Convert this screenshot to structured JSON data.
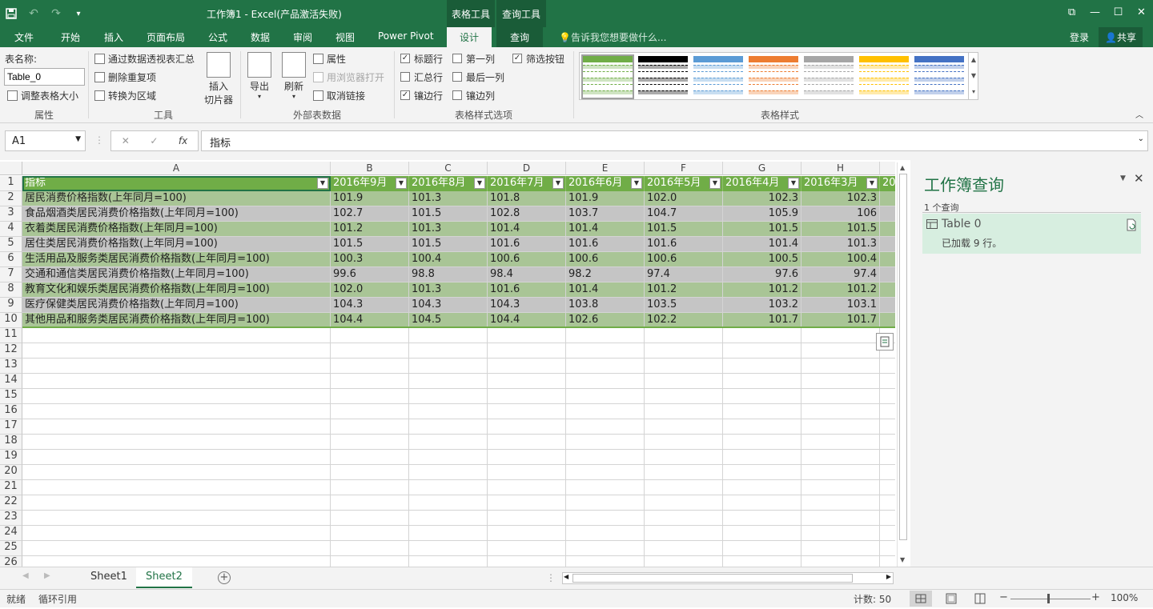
{
  "window": {
    "title": "工作簿1 - Excel(产品激活失败)",
    "context_tabs": [
      "表格工具",
      "查询工具"
    ],
    "controls": [
      "⧉",
      "—",
      "☐",
      "✕"
    ]
  },
  "menu": {
    "tabs": [
      "文件",
      "开始",
      "插入",
      "页面布局",
      "公式",
      "数据",
      "审阅",
      "视图",
      "Power Pivot",
      "设计",
      "查询"
    ],
    "tell_me": "告诉我您想要做什么...",
    "login": "登录",
    "share": "共享"
  },
  "ribbon": {
    "props": {
      "label": "表名称:",
      "table_name": "Table_0",
      "resize": "调整表格大小",
      "group": "属性"
    },
    "tools": {
      "pivot": "通过数据透视表汇总",
      "dedupe": "删除重复项",
      "to_range": "转换为区域",
      "slicer_1": "插入",
      "slicer_2": "切片器",
      "group": "工具"
    },
    "external": {
      "export": "导出",
      "refresh": "刷新",
      "properties": "属性",
      "open_browser": "用浏览器打开",
      "unlink": "取消链接",
      "group": "外部表数据"
    },
    "style_options": {
      "header_row": "标题行",
      "total_row": "汇总行",
      "banded_rows": "镶边行",
      "first_col": "第一列",
      "last_col": "最后一列",
      "banded_cols": "镶边列",
      "filter_btn": "筛选按钮",
      "group": "表格样式选项"
    },
    "styles": {
      "group": "表格样式",
      "swatches": [
        "#70ad47",
        "#000000",
        "#5b9bd5",
        "#ed7d31",
        "#a5a5a5",
        "#ffc000",
        "#4472c4"
      ]
    }
  },
  "formula_bar": {
    "cell": "A1",
    "cancel": "✕",
    "enter": "✓",
    "fx": "fx",
    "content": "指标"
  },
  "sheet": {
    "columns": [
      "A",
      "B",
      "C",
      "D",
      "E",
      "F",
      "G",
      "H"
    ],
    "header": [
      "指标",
      "2016年9月",
      "2016年8月",
      "2016年7月",
      "2016年6月",
      "2016年5月",
      "2016年4月",
      "2016年3月",
      "20"
    ],
    "rows": [
      [
        "居民消费价格指数(上年同月=100)",
        "101.9",
        "101.3",
        "101.8",
        "101.9",
        "102.0",
        "102.3",
        "102.3"
      ],
      [
        "食品烟酒类居民消费价格指数(上年同月=100)",
        "102.7",
        "101.5",
        "102.8",
        "103.7",
        "104.7",
        "105.9",
        "106"
      ],
      [
        "衣着类居民消费价格指数(上年同月=100)",
        "101.2",
        "101.3",
        "101.4",
        "101.4",
        "101.5",
        "101.5",
        "101.5"
      ],
      [
        "居住类居民消费价格指数(上年同月=100)",
        "101.5",
        "101.5",
        "101.6",
        "101.6",
        "101.6",
        "101.4",
        "101.3"
      ],
      [
        "生活用品及服务类居民消费价格指数(上年同月=100)",
        "100.3",
        "100.4",
        "100.6",
        "100.6",
        "100.6",
        "100.5",
        "100.4"
      ],
      [
        "交通和通信类居民消费价格指数(上年同月=100)",
        "99.6",
        "98.8",
        "98.4",
        "98.2",
        "97.4",
        "97.6",
        "97.4"
      ],
      [
        "教育文化和娱乐类居民消费价格指数(上年同月=100)",
        "102.0",
        "101.3",
        "101.6",
        "101.4",
        "101.2",
        "101.2",
        "101.2"
      ],
      [
        "医疗保健类居民消费价格指数(上年同月=100)",
        "104.3",
        "104.3",
        "104.3",
        "103.8",
        "103.5",
        "103.2",
        "103.1"
      ],
      [
        "其他用品和服务类居民消费价格指数(上年同月=100)",
        "104.4",
        "104.5",
        "104.4",
        "102.6",
        "102.2",
        "101.7",
        "101.7"
      ]
    ],
    "row_numbers": [
      "1",
      "2",
      "3",
      "4",
      "5",
      "6",
      "7",
      "8",
      "9",
      "10",
      "11",
      "12",
      "13",
      "14",
      "15",
      "16",
      "17",
      "18",
      "19",
      "20",
      "21",
      "22",
      "23",
      "24",
      "25",
      "26"
    ]
  },
  "sheets": {
    "tabs": [
      "Sheet1",
      "Sheet2"
    ],
    "add": "+"
  },
  "status": {
    "ready": "就绪",
    "circular": "循环引用",
    "count": "计数: 50",
    "zoom": "100%",
    "minus": "−",
    "plus": "+"
  },
  "queries_panel": {
    "title": "工作簿查询",
    "count": "1 个查询",
    "query_name": "Table 0",
    "query_status": "已加载 9 行。"
  }
}
